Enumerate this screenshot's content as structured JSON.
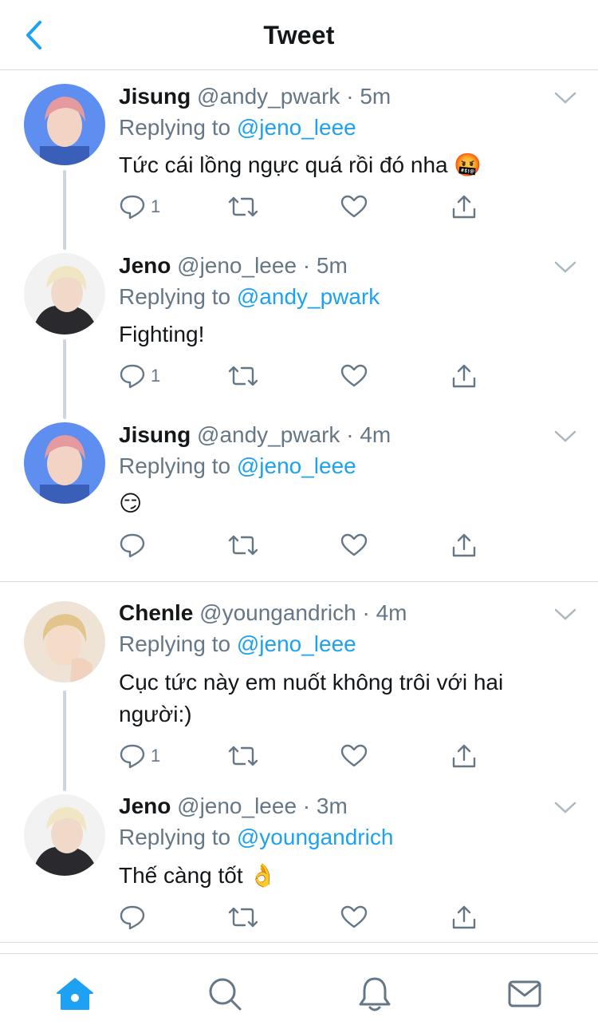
{
  "header": {
    "title": "Tweet",
    "back_icon": "chevron-left-icon"
  },
  "colors": {
    "accent": "#1da1f2",
    "secondary_text": "#657786",
    "divider": "#d6dbe0",
    "thread_line": "#ccd6dd"
  },
  "tweets": [
    {
      "name": "Jisung",
      "handle": "@andy_pwark",
      "dot": "·",
      "time": "5m",
      "reply_prefix": "Replying to ",
      "reply_to": "@jeno_leee",
      "text": "Tức cái lồng ngực quá rồi đó nha 🤬",
      "reply_count": "1"
    },
    {
      "name": "Jeno",
      "handle": "@jeno_leee",
      "dot": "·",
      "time": "5m",
      "reply_prefix": "Replying to ",
      "reply_to": "@andy_pwark",
      "text": "Fighting!",
      "reply_count": "1"
    },
    {
      "name": "Jisung",
      "handle": "@andy_pwark",
      "dot": "·",
      "time": "4m",
      "reply_prefix": "Replying to ",
      "reply_to": "@jeno_leee",
      "text": "😏",
      "reply_count": ""
    },
    {
      "name": "Chenle",
      "handle": "@youngandrich",
      "dot": "·",
      "time": "4m",
      "reply_prefix": "Replying to ",
      "reply_to": "@jeno_leee",
      "text": "Cục tức này em nuốt không trôi với hai người:)",
      "reply_count": "1"
    },
    {
      "name": "Jeno",
      "handle": "@jeno_leee",
      "dot": "·",
      "time": "3m",
      "reply_prefix": "Replying to ",
      "reply_to": "@youngandrich",
      "text": "Thế càng tốt 👌",
      "reply_count": ""
    }
  ],
  "tabbar": {
    "items": [
      "home-icon",
      "search-icon",
      "bell-icon",
      "mail-icon"
    ]
  }
}
